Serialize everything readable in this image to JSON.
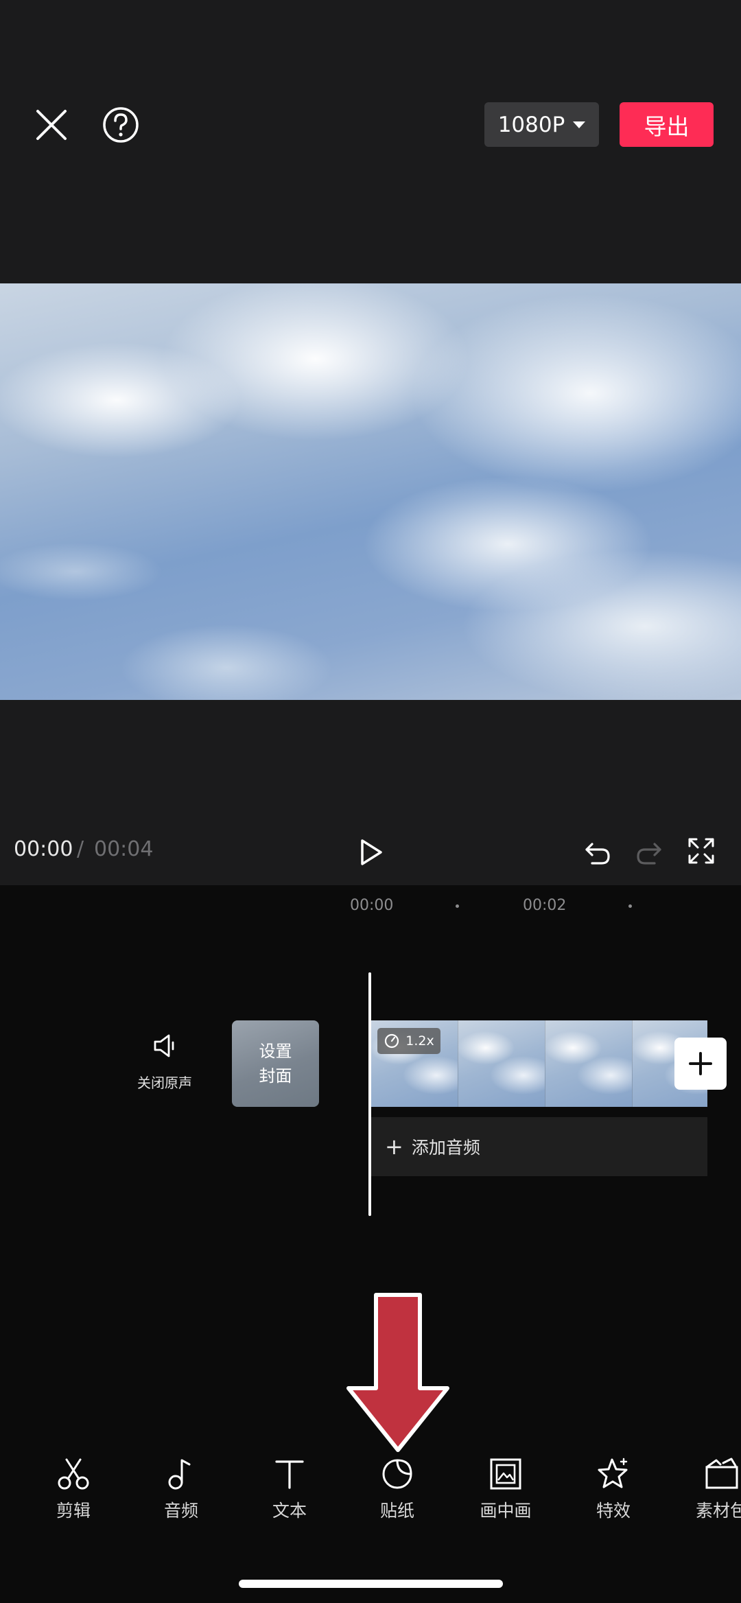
{
  "header": {
    "close_icon": "close-icon",
    "help_icon": "help-icon",
    "resolution": "1080P",
    "export_label": "导出",
    "export_color": "#fe2c55"
  },
  "player": {
    "current_time": "00:00",
    "separator": "/",
    "total_time": "00:04",
    "play_icon": "play-icon",
    "undo_icon": "undo-icon",
    "redo_icon": "redo-icon",
    "fullscreen_icon": "fullscreen-icon"
  },
  "ruler": {
    "marks": [
      "00:00",
      "00:02"
    ]
  },
  "timeline": {
    "mute_label": "关闭原声",
    "cover_line1": "设置",
    "cover_line2": "封面",
    "speed": "1.2x",
    "add_audio": "添加音频"
  },
  "toolbar": {
    "items": [
      {
        "label": "剪辑",
        "icon": "scissors-icon"
      },
      {
        "label": "音频",
        "icon": "music-note-icon"
      },
      {
        "label": "文本",
        "icon": "text-icon"
      },
      {
        "label": "贴纸",
        "icon": "sticker-icon"
      },
      {
        "label": "画中画",
        "icon": "picture-in-picture-icon"
      },
      {
        "label": "特效",
        "icon": "effects-star-icon"
      },
      {
        "label": "素材包",
        "icon": "material-pack-icon"
      }
    ]
  },
  "annotation": {
    "arrow_color": "#c0323f"
  }
}
